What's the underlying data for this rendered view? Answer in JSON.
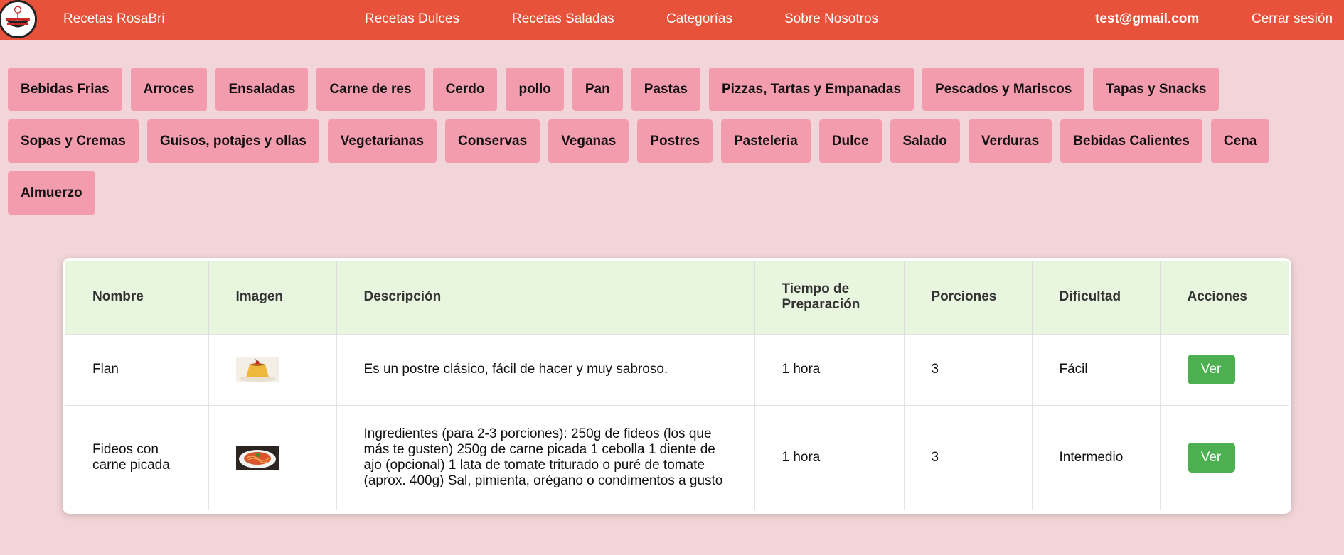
{
  "brand": "Recetas RosaBri",
  "nav": {
    "links": [
      "Recetas Dulces",
      "Recetas Saladas",
      "Categorías",
      "Sobre Nosotros"
    ],
    "user": "test@gmail.com",
    "logout": "Cerrar sesión"
  },
  "categories": [
    "Bebidas Frias",
    "Arroces",
    "Ensaladas",
    "Carne de res",
    "Cerdo",
    "pollo",
    "Pan",
    "Pastas",
    "Pizzas, Tartas y Empanadas",
    "Pescados y Mariscos",
    "Tapas y Snacks",
    "Sopas y Cremas",
    "Guisos, potajes y ollas",
    "Vegetarianas",
    "Conservas",
    "Veganas",
    "Postres",
    "Pasteleria",
    "Dulce",
    "Salado",
    "Verduras",
    "Bebidas Calientes",
    "Cena",
    "Almuerzo"
  ],
  "table": {
    "headers": {
      "nombre": "Nombre",
      "imagen": "Imagen",
      "descripcion": "Descripción",
      "tiempo": "Tiempo de Preparación",
      "porciones": "Porciones",
      "dificultad": "Dificultad",
      "acciones": "Acciones"
    },
    "rows": [
      {
        "nombre": "Flan",
        "image_icon": "flan-thumbnail",
        "descripcion": "Es un postre clásico, fácil de hacer y muy sabroso.",
        "tiempo": "1 hora",
        "porciones": "3",
        "dificultad": "Fácil",
        "action": "Ver"
      },
      {
        "nombre": "Fideos con carne picada",
        "image_icon": "pasta-thumbnail",
        "descripcion": "Ingredientes (para 2-3 porciones): 250g de fideos (los que más te gusten) 250g de carne picada 1 cebolla 1 diente de ajo (opcional) 1 lata de tomate triturado o puré de tomate (aprox. 400g) Sal, pimienta, orégano o condimentos a gusto",
        "tiempo": "1 hora",
        "porciones": "3",
        "dificultad": "Intermedio",
        "action": "Ver"
      }
    ]
  },
  "colors": {
    "navbar": "#e8523a",
    "background": "#f2d5d8",
    "category_chip": "#f29cae",
    "table_header": "#e8f5df",
    "button": "#4caf50"
  }
}
